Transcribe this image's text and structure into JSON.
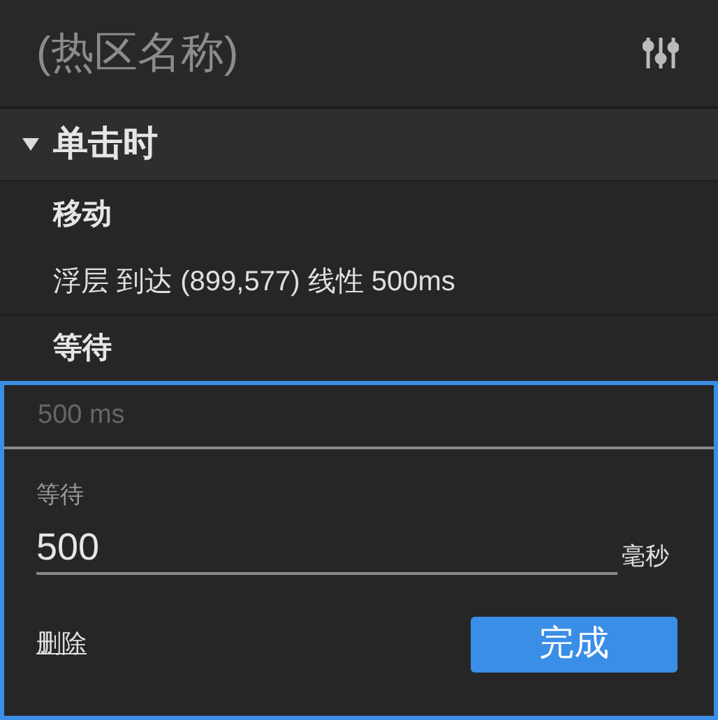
{
  "header": {
    "title": "(热区名称)"
  },
  "section": {
    "title": "单击时",
    "expanded": true,
    "actions": [
      {
        "name": "移动",
        "detail": "浮层 到达 (899,577) 线性 500ms"
      },
      {
        "name": "等待",
        "detail": "500 ms"
      }
    ]
  },
  "editor": {
    "label": "等待",
    "value": "500",
    "unit": "毫秒",
    "delete": "删除",
    "done": "完成"
  }
}
